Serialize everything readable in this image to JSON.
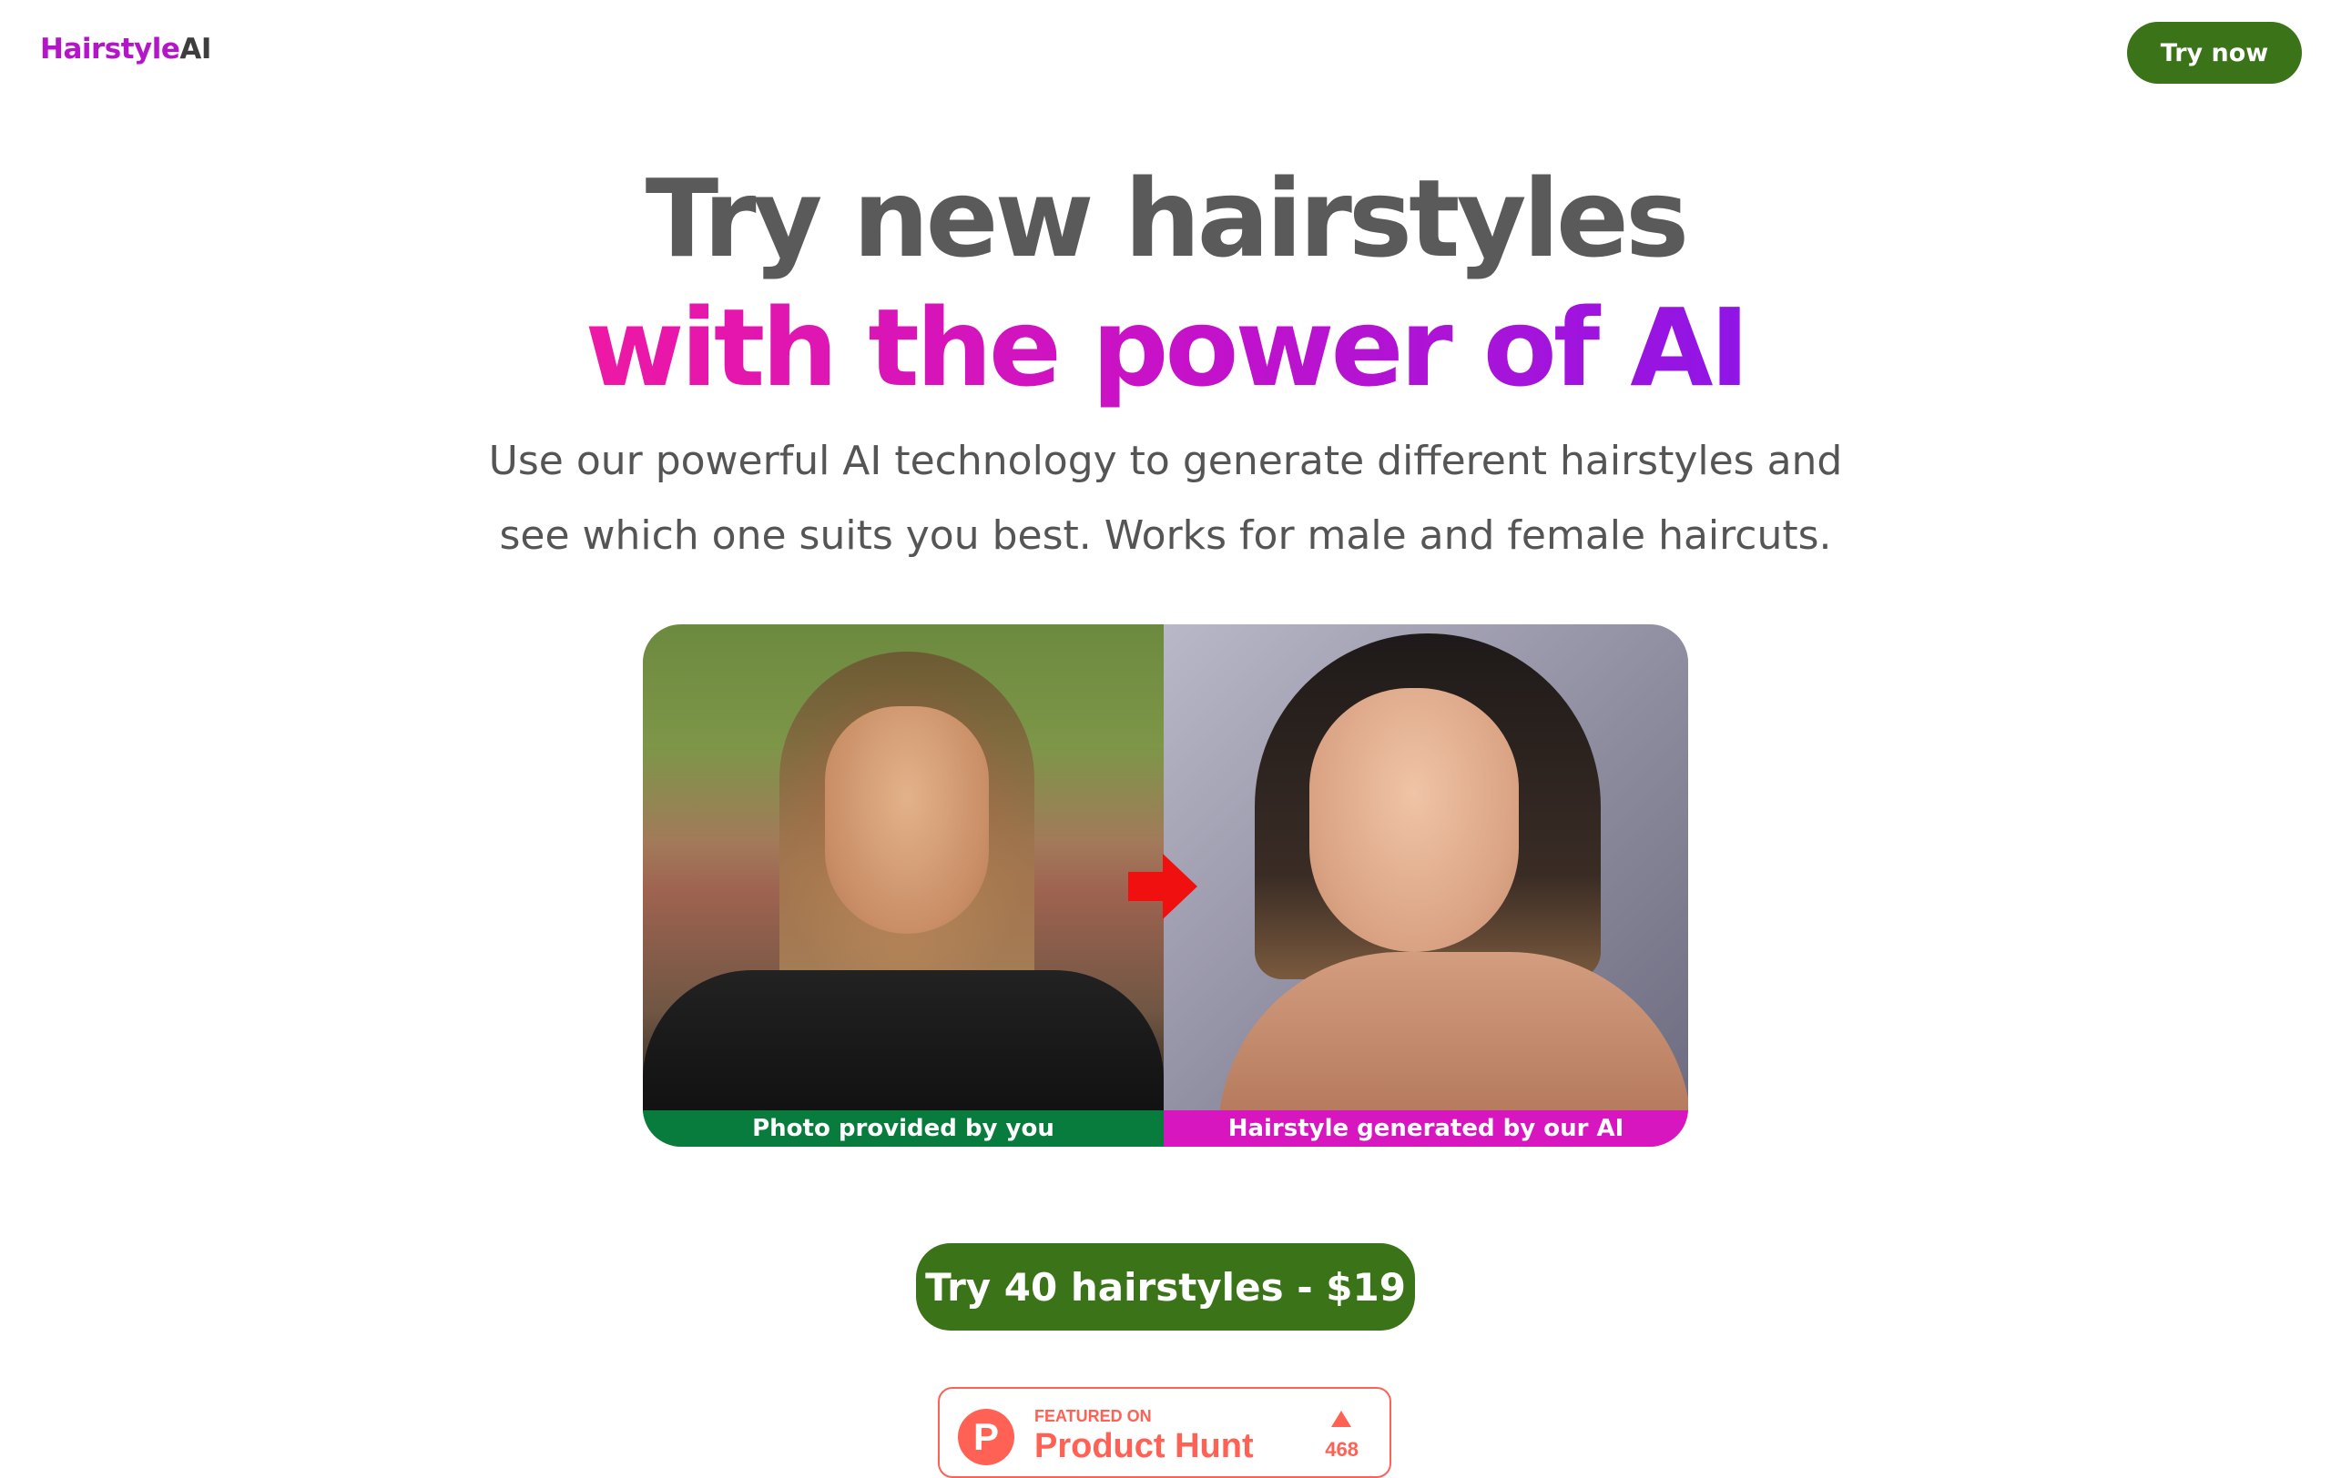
{
  "navbar": {
    "logo_part1": "Hairstyle",
    "logo_part2": "AI",
    "cta_label": "Try now"
  },
  "hero": {
    "title_line1": "Try new hairstyles",
    "title_line2": "with the power of AI",
    "subtitle": "Use our powerful AI technology to generate different hairstyles and see which one suits you best. Works for male and female haircuts."
  },
  "comparison": {
    "left_caption": "Photo provided by you",
    "right_caption": "Hairstyle generated by our AI",
    "arrow_icon": "right-arrow-icon"
  },
  "cta": {
    "label": "Try 40 hairstyles - $19"
  },
  "product_hunt": {
    "logo_letter": "P",
    "featured_label": "FEATURED ON",
    "name": "Product Hunt",
    "upvotes": "468"
  },
  "colors": {
    "brand_green": "#3a7318",
    "brand_pink": "#ee18a4",
    "brand_purple": "#8f15e6",
    "caption_green": "#087c3d",
    "caption_magenta": "#d816c0",
    "product_hunt": "#ff6154"
  }
}
